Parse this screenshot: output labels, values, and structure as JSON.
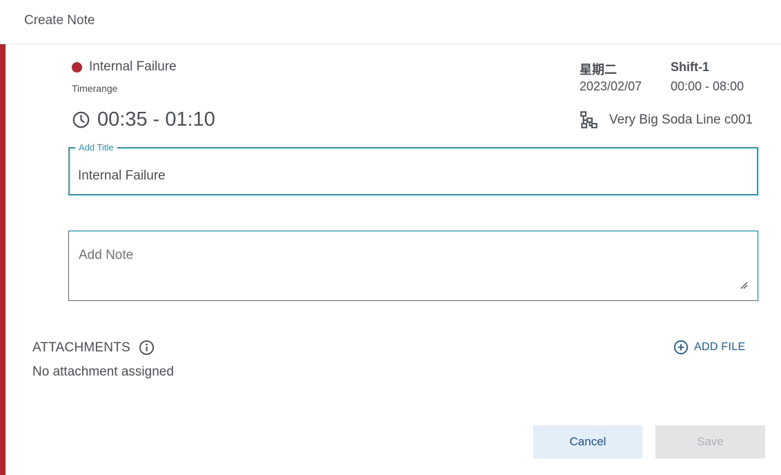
{
  "header": {
    "title": "Create Note"
  },
  "colors": {
    "accent": "#b4262f",
    "focus": "#1e9bc6",
    "link": "#1a5a9c"
  },
  "event": {
    "name": "Internal Failure",
    "timerange_label": "Timerange",
    "time_range": "00:35 - 01:10",
    "dot_color": "#b4262f",
    "icon": "clock-icon"
  },
  "schedule": {
    "day": "星期二",
    "date": "2023/02/07",
    "shift": "Shift-1",
    "shift_time": "00:00 - 08:00"
  },
  "line": {
    "name": "Very Big Soda Line c001",
    "icon": "hierarchy-icon"
  },
  "form": {
    "title_legend": "Add Title",
    "title_value": "Internal Failure",
    "note_placeholder": "Add Note",
    "note_value": ""
  },
  "attachments": {
    "title": "ATTACHMENTS",
    "empty_text": "No attachment assigned",
    "add_label": "ADD FILE",
    "icons": [
      "info-icon",
      "plus-circle-icon"
    ]
  },
  "actions": {
    "cancel_label": "Cancel",
    "save_label": "Save",
    "save_disabled": true
  }
}
